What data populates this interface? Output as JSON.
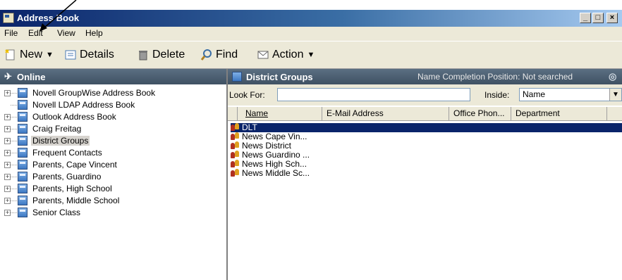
{
  "window": {
    "title": "Address Book",
    "minimize": "_",
    "maximize": "□",
    "close": "×"
  },
  "menubar": [
    "File",
    "Edit",
    "View",
    "Help"
  ],
  "toolbar": {
    "new": "New",
    "details": "Details",
    "delete": "Delete",
    "find": "Find",
    "action": "Action"
  },
  "left_pane": {
    "header": "Online",
    "items": [
      {
        "label": "Novell GroupWise Address Book",
        "expandable": true
      },
      {
        "label": "Novell LDAP Address Book",
        "expandable": false
      },
      {
        "label": "Outlook Address Book",
        "expandable": true
      },
      {
        "label": "Craig Freitag",
        "expandable": true
      },
      {
        "label": "District Groups",
        "expandable": true,
        "selected": true
      },
      {
        "label": "Frequent Contacts",
        "expandable": true
      },
      {
        "label": "Parents, Cape Vincent",
        "expandable": true
      },
      {
        "label": "Parents, Guardino",
        "expandable": true
      },
      {
        "label": "Parents, High School",
        "expandable": true
      },
      {
        "label": "Parents, Middle School",
        "expandable": true
      },
      {
        "label": "Senior Class",
        "expandable": true
      }
    ]
  },
  "right_pane": {
    "header": "District Groups",
    "status": "Name Completion Position:  Not searched",
    "look_for_label": "Look For:",
    "look_for_value": "",
    "inside_label": "Inside:",
    "inside_value": "Name",
    "columns": [
      "Name",
      "E-Mail Address",
      "Office Phon...",
      "Department"
    ],
    "rows": [
      "DLT",
      "News Cape Vin...",
      "News District",
      "News Guardino ...",
      "News High Sch...",
      "News Middle Sc..."
    ]
  }
}
